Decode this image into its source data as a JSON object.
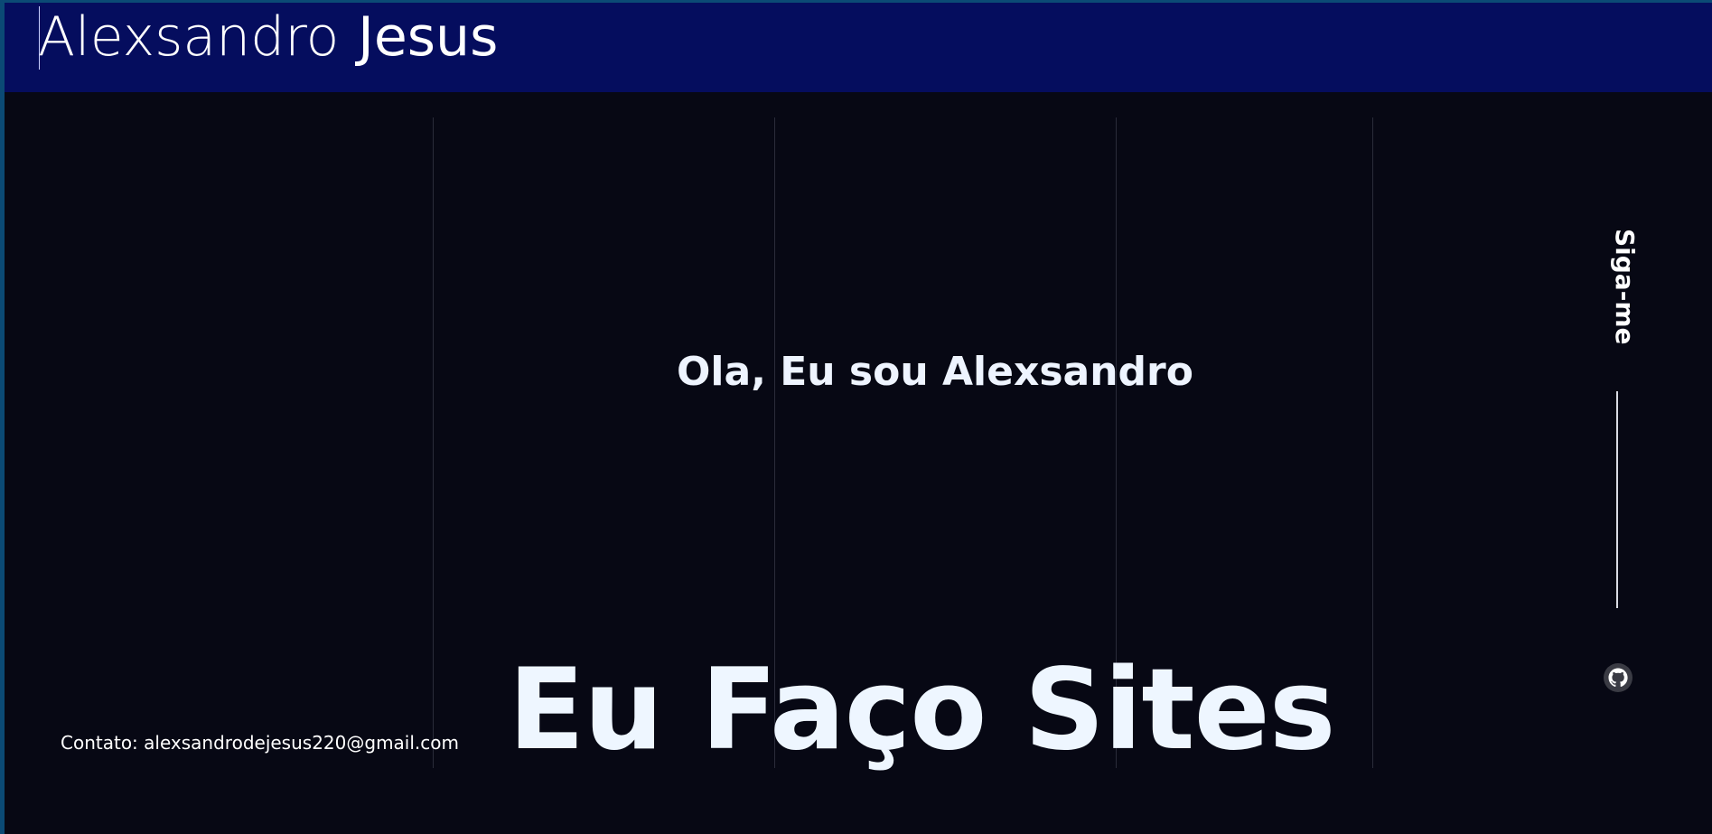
{
  "header": {
    "brand_first": "Alexsandro",
    "brand_last": "Jesus"
  },
  "hero": {
    "greeting": "Ola, Eu sou Alexsandro",
    "headline": "Eu Faço Sites"
  },
  "contact": {
    "text": "Contato: alexsandrodejesus220@gmail.com"
  },
  "social": {
    "label": "Siga-me",
    "links": [
      {
        "icon": "github-icon"
      }
    ]
  },
  "colors": {
    "header_bg": "#050d5e",
    "page_bg": "#070814",
    "text": "#eef4ff"
  }
}
